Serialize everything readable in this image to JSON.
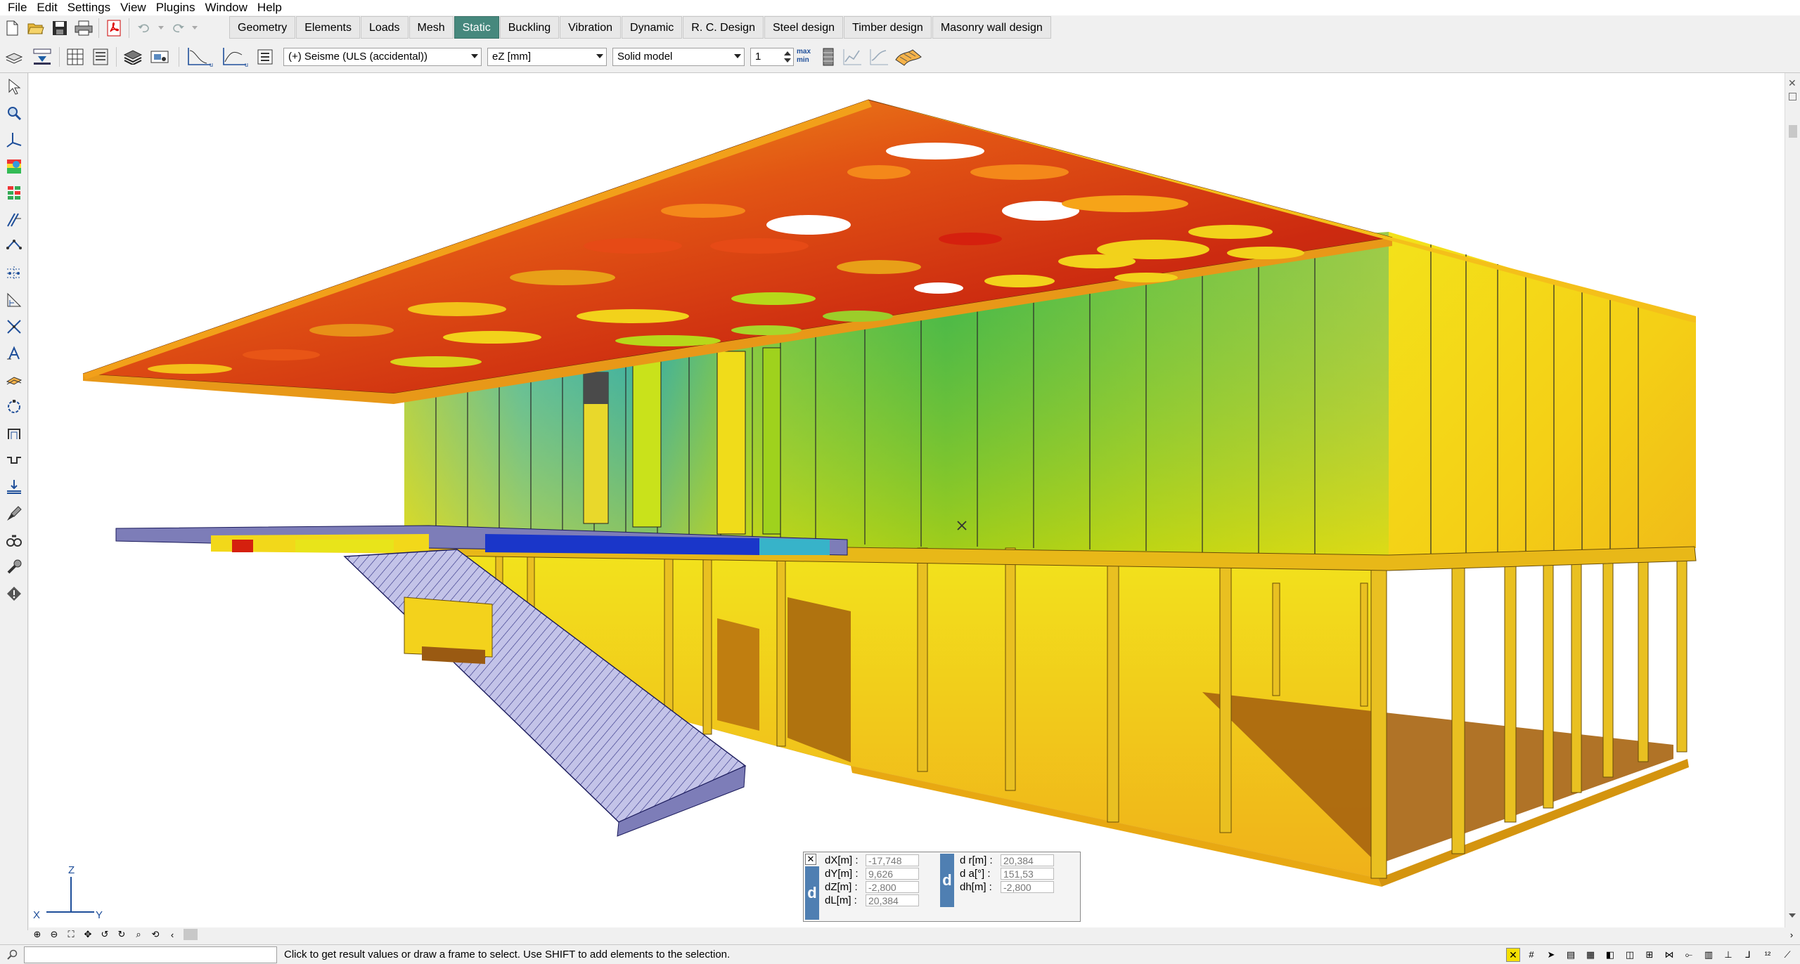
{
  "menu": [
    "File",
    "Edit",
    "Settings",
    "View",
    "Plugins",
    "Window",
    "Help"
  ],
  "tabs": [
    {
      "label": "Geometry",
      "active": false
    },
    {
      "label": "Elements",
      "active": false
    },
    {
      "label": "Loads",
      "active": false
    },
    {
      "label": "Mesh",
      "active": false
    },
    {
      "label": "Static",
      "active": true
    },
    {
      "label": "Buckling",
      "active": false
    },
    {
      "label": "Vibration",
      "active": false
    },
    {
      "label": "Dynamic",
      "active": false
    },
    {
      "label": "R. C. Design",
      "active": false
    },
    {
      "label": "Steel design",
      "active": false
    },
    {
      "label": "Timber design",
      "active": false
    },
    {
      "label": "Masonry wall design",
      "active": false
    }
  ],
  "results_toolbar": {
    "load_case": "(+) Seisme (ULS (accidental))",
    "component": "eZ [mm]",
    "display_mode": "Solid model",
    "step_value": "1",
    "extreme_max_label": "max",
    "extreme_min_label": "min"
  },
  "measure": {
    "left": [
      {
        "label": "dX[m] :",
        "value": "-17,748"
      },
      {
        "label": "dY[m] :",
        "value": "9,626"
      },
      {
        "label": "dZ[m] :",
        "value": "-2,800"
      },
      {
        "label": "dL[m] :",
        "value": "20,384"
      }
    ],
    "right": [
      {
        "label": "d r[m] :",
        "value": "20,384"
      },
      {
        "label": "d a[°] :",
        "value": "151,53"
      },
      {
        "label": "dh[m] :",
        "value": "-2,800"
      }
    ],
    "badge": "d"
  },
  "axes": {
    "x": "X",
    "y": "Y",
    "z": "Z"
  },
  "status_text": "Click to get result values or draw a frame to select. Use SHIFT to add elements to the selection.",
  "colors": {
    "active_tab": "#46887d",
    "accent": "#4f7fb2"
  }
}
